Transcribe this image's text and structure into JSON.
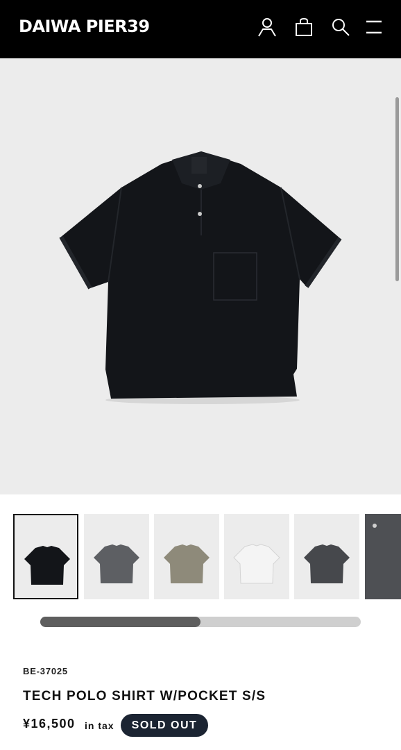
{
  "header": {
    "logo": "DAIWA PIER39",
    "icons": [
      "account-icon",
      "bag-icon",
      "search-icon",
      "menu-icon"
    ]
  },
  "gallery": {
    "main_image_color": "#131519",
    "variant_colors": [
      "#131519",
      "#5d5f63",
      "#8e8a7a",
      "#f4f4f4",
      "#46484c",
      "#4e5054"
    ],
    "selected_index": 0,
    "scroll_progress": 0.5
  },
  "product": {
    "sku": "BE-37025",
    "name": "TECH POLO SHIRT W/POCKET S/S",
    "price": "¥16,500",
    "tax_label": "in tax",
    "status": "SOLD OUT"
  },
  "colors": {
    "header_bg": "#000000",
    "hero_bg": "#ececec",
    "badge_bg": "#1b2432"
  }
}
